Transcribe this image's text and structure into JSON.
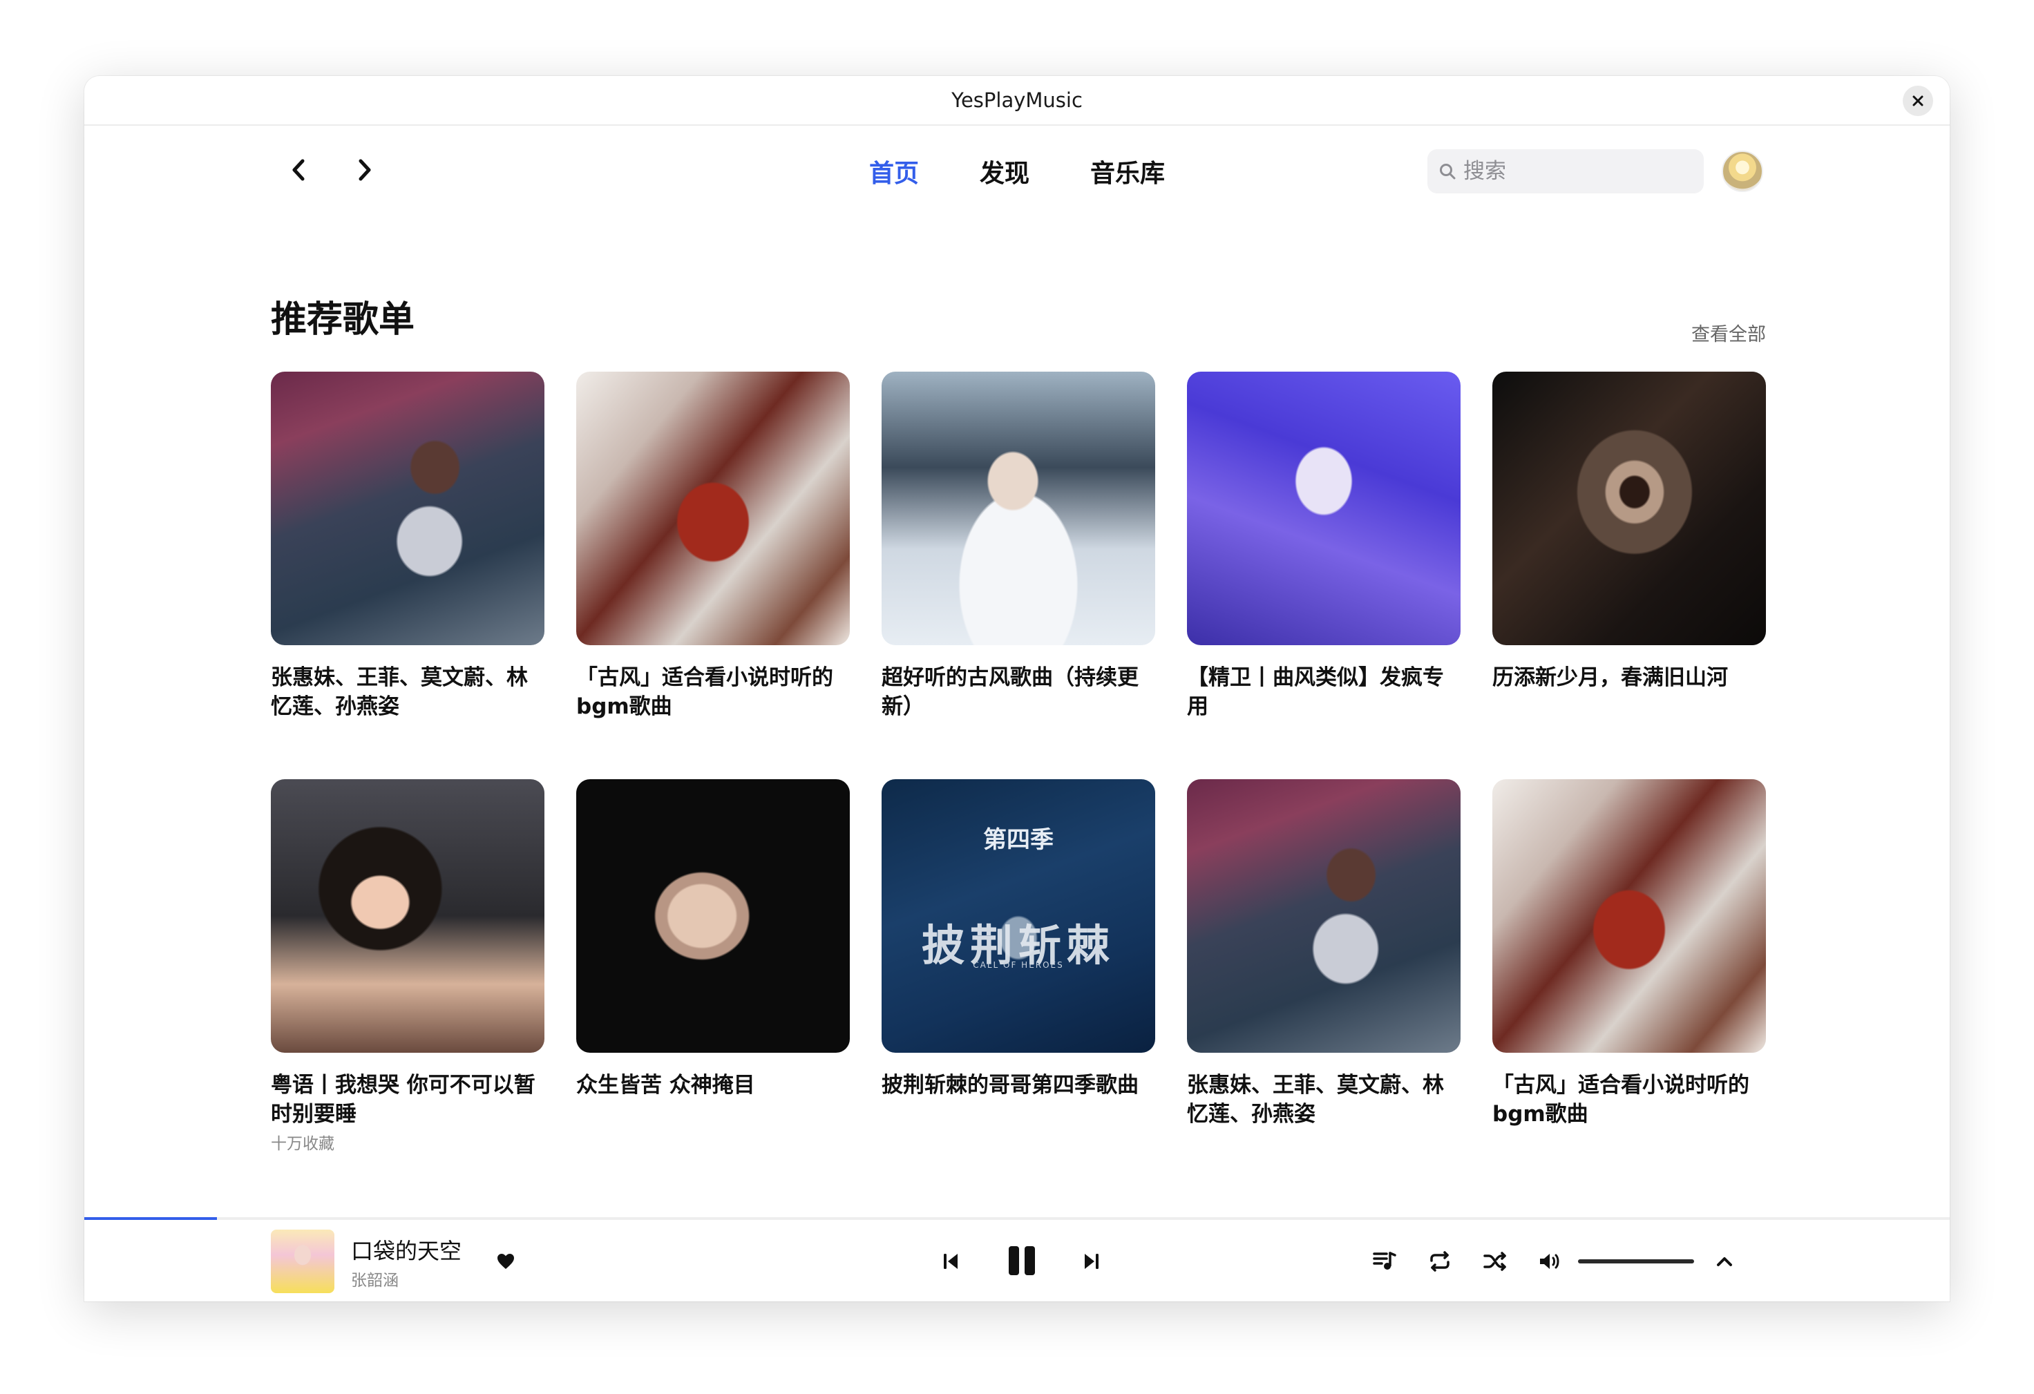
{
  "window": {
    "title": "YesPlayMusic"
  },
  "nav": {
    "links": [
      {
        "label": "首页",
        "active": true
      },
      {
        "label": "发现",
        "active": false
      },
      {
        "label": "音乐库",
        "active": false
      }
    ],
    "search": {
      "placeholder": "搜索",
      "value": ""
    }
  },
  "section": {
    "title": "推荐歌单",
    "see_all": "查看全部"
  },
  "playlists": [
    {
      "title": "张惠妹、王菲、莫文蔚、林忆莲、孙燕姿",
      "subtitle": ""
    },
    {
      "title": "「古风」适合看小说时听的bgm歌曲",
      "subtitle": ""
    },
    {
      "title": "超好听的古风歌曲（持续更新）",
      "subtitle": ""
    },
    {
      "title": "【精卫丨曲风类似】发疯专用",
      "subtitle": ""
    },
    {
      "title": "历添新少月，春满旧山河",
      "subtitle": ""
    },
    {
      "title": "粤语丨我想哭 你可不可以暂时别要睡",
      "subtitle": "十万收藏"
    },
    {
      "title": "众生皆苦 众神掩目",
      "subtitle": ""
    },
    {
      "title": "披荆斩棘的哥哥第四季歌曲",
      "subtitle": ""
    },
    {
      "title": "张惠妹、王菲、莫文蔚、林忆莲、孙燕姿",
      "subtitle": ""
    },
    {
      "title": "「古风」适合看小说时听的bgm歌曲",
      "subtitle": ""
    }
  ],
  "cover_text": {
    "season": "第四季",
    "show": "披荆斩棘",
    "english": "CALL OF HEROES"
  },
  "player": {
    "track_title": "口袋的天空",
    "artist": "张韶涵",
    "progress": 0.071,
    "volume": 1.0,
    "accent": "#335eea",
    "icons": [
      "heart-icon",
      "previous-icon",
      "pause-icon",
      "next-icon",
      "playlist-icon",
      "repeat-icon",
      "shuffle-icon",
      "volume-icon",
      "chevron-up-icon"
    ]
  }
}
